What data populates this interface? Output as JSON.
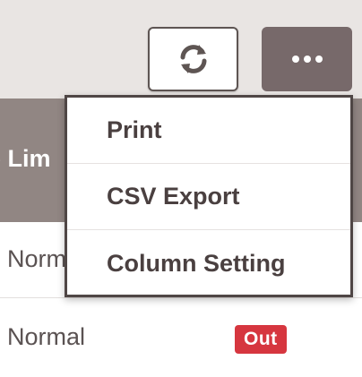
{
  "toolbar": {
    "refresh_icon": "refresh-icon",
    "more_icon": "more-horizontal-icon"
  },
  "table": {
    "header_fragment": "e Lim",
    "rows": [
      {
        "status": "Norm"
      },
      {
        "status": "Normal",
        "badge": "Out"
      }
    ]
  },
  "menu": {
    "items": [
      {
        "label": "Print"
      },
      {
        "label": "CSV Export"
      },
      {
        "label": "Column Setting"
      }
    ]
  },
  "colors": {
    "accent_dark": "#77696a",
    "header_bg": "#918683",
    "badge_red": "#d6363f"
  }
}
